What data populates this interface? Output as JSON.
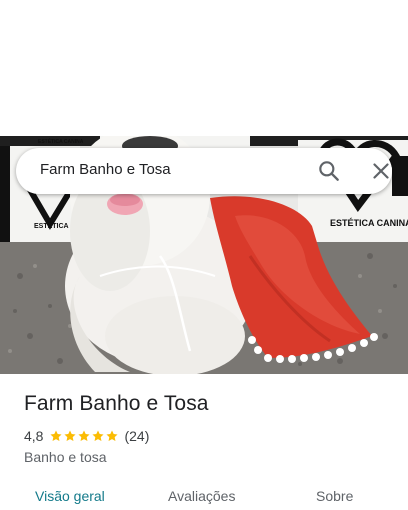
{
  "search": {
    "query": "Farm Banho e Tosa"
  },
  "photo": {
    "sign_text_left": "ESTÉTICA CANINA",
    "sign_text_right": "ESTÉTICA CANINA",
    "sign_text_top": "ESTÉTICA CANINA"
  },
  "place": {
    "name": "Farm Banho e Tosa",
    "rating": "4,8",
    "rating_value": 4.8,
    "stars_filled": 5,
    "review_count": "(24)",
    "category": "Banho e tosa"
  },
  "tabs": [
    {
      "label": "Visão geral",
      "active": true
    },
    {
      "label": "Avaliações",
      "active": false
    },
    {
      "label": "Sobre",
      "active": false
    }
  ],
  "colors": {
    "star": "#fbbc04",
    "active_tab": "#137a8a",
    "cape_red": "#d93a2b"
  },
  "icons": {
    "search": "search-icon",
    "close": "close-icon",
    "star": "star-icon"
  }
}
